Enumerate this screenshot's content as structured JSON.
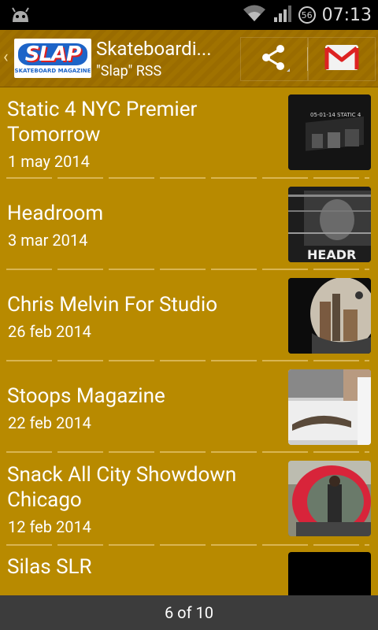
{
  "status": {
    "time": "07:13",
    "badge": "56"
  },
  "header": {
    "logo_text": "SLAP",
    "logo_sub": "SKATEBOARD MAGAZINE",
    "title": "Skateboardi...",
    "subtitle": "\"Slap\" RSS"
  },
  "items": [
    {
      "title_line1": "Static 4 NYC Premier",
      "title_line2": "Tomorrow",
      "date": "1 may 2014"
    },
    {
      "title_line1": "Headroom",
      "date": "3 mar 2014",
      "thumb_text": "HEADR"
    },
    {
      "title_line1": "Chris Melvin For Studio",
      "date": "26 feb 2014"
    },
    {
      "title_line1": "Stoops Magazine",
      "date": "22 feb 2014"
    },
    {
      "title_line1": "Snack All City Showdown",
      "title_line2": "Chicago",
      "date": "12 feb 2014"
    },
    {
      "title_line1": "Silas SLR"
    }
  ],
  "thumb0_text": "05-01-14 STATIC 4",
  "footer": {
    "page_indicator": "6 of 10"
  }
}
